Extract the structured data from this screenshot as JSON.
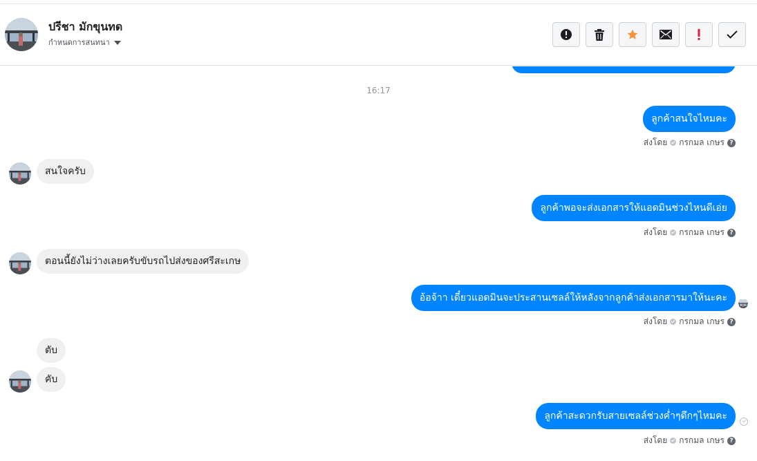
{
  "contact": {
    "name": "ปรีชา มักขุนทด",
    "subtitle": "กำหนดการสนทนา"
  },
  "toolbar": [
    {
      "name": "spam-button",
      "icon": "alert-circle-icon",
      "color": "#1c1e21"
    },
    {
      "name": "delete-button",
      "icon": "trash-icon",
      "color": "#1c1e21"
    },
    {
      "name": "star-button",
      "icon": "star-icon",
      "color": "#f7923b"
    },
    {
      "name": "mark-unread-button",
      "icon": "envelope-icon",
      "color": "#1c1e21"
    },
    {
      "name": "follow-up-button",
      "icon": "exclamation-icon",
      "color": "#e41e3f"
    },
    {
      "name": "done-button",
      "icon": "checkmark-icon",
      "color": "#1c1e21"
    }
  ],
  "colors": {
    "outgoing_bubble": "#0084ff",
    "incoming_bubble": "#f1f0f0"
  },
  "thread": {
    "timestamp": "16:17",
    "sent_by_label": "ส่งโดย",
    "sender_name": "กรกมล เกษร",
    "messages": [
      {
        "direction": "out",
        "text": "ลูกค้าสนใจไหมคะ"
      },
      {
        "direction": "in",
        "text": "สนใจครับ"
      },
      {
        "direction": "out",
        "text": "ลูกค้าพอจะส่งเอกสารให้แอดมินช่วงไหนดีเอ่ย"
      },
      {
        "direction": "in",
        "text": "ตอนนี้ยังไม่ว่างเลยครับขับรถไปส่งของศรีสะเกษ"
      },
      {
        "direction": "out",
        "text": "อ้อจ้าา เดี๋ยวแอดมินจะประสานเซลล์ให้หลังจากลูกค้าส่งเอกสารมาให้นะคะ"
      },
      {
        "direction": "in",
        "text": "ตับ"
      },
      {
        "direction": "in",
        "text": "คับ"
      },
      {
        "direction": "out",
        "text": "ลูกค้าสะดวกรับสายเซลล์ช่วงค่ำๆดึกๆไหมคะ"
      }
    ]
  }
}
